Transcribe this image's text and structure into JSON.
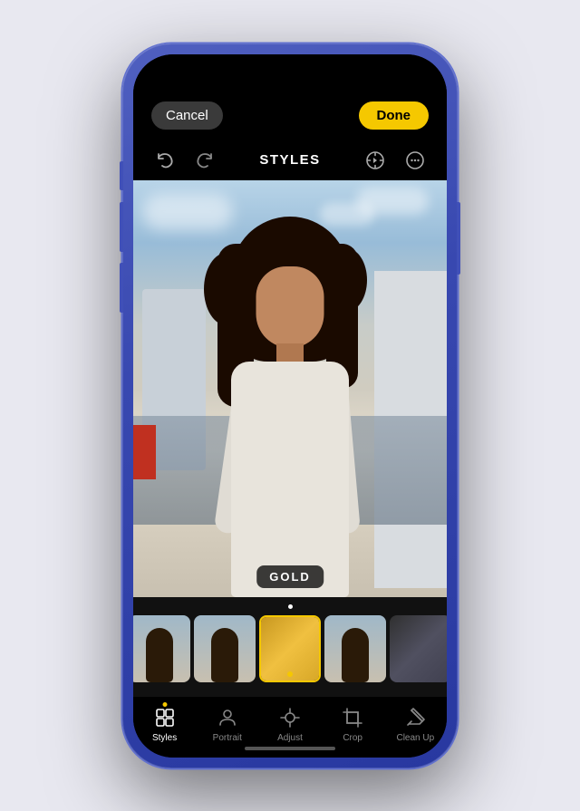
{
  "phone": {
    "screen": {
      "header": {
        "cancel_label": "Cancel",
        "done_label": "Done",
        "title": "STYLES"
      },
      "photo": {
        "filter_label": "GOLD"
      },
      "bottom_nav": {
        "items": [
          {
            "id": "styles",
            "label": "Styles",
            "active": true
          },
          {
            "id": "portrait",
            "label": "Portrait",
            "active": false
          },
          {
            "id": "adjust",
            "label": "Adjust",
            "active": false
          },
          {
            "id": "crop",
            "label": "Crop",
            "active": false
          },
          {
            "id": "cleanup",
            "label": "Clean Up",
            "active": false
          }
        ]
      }
    }
  },
  "colors": {
    "done_bg": "#f5c800",
    "cancel_bg": "#3a3a3a",
    "active_nav": "#ffffff",
    "inactive_nav": "#888888",
    "active_indicator": "#f5c800"
  }
}
